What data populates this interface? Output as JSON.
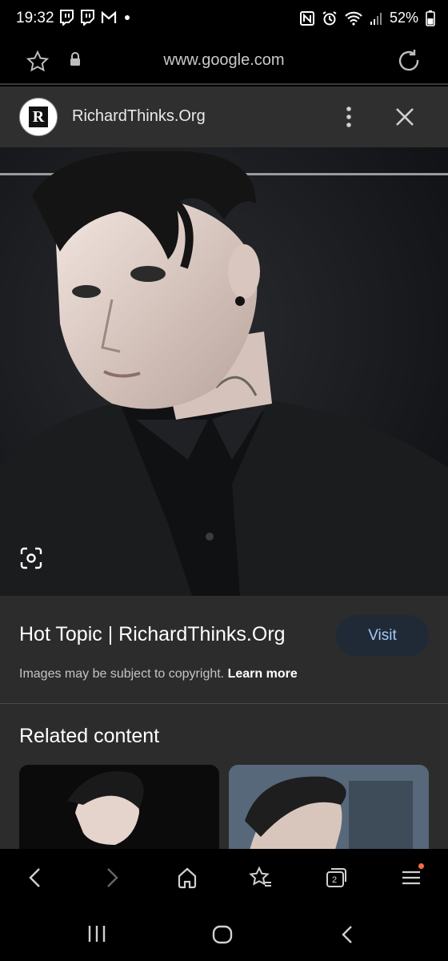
{
  "status_bar": {
    "time": "19:32",
    "battery_pct": "52%",
    "notification_icons": [
      "twitch-icon",
      "twitch-icon",
      "gmail-icon",
      "dot-icon"
    ],
    "system_icons": [
      "nfc-icon",
      "alarm-icon",
      "wifi-icon",
      "signal-icon",
      "battery-icon"
    ]
  },
  "url_bar": {
    "url": "www.google.com"
  },
  "panel": {
    "site_name": "RichardThinks.Org",
    "favicon_letter": "R"
  },
  "result": {
    "title": "Hot Topic | RichardThinks.Org",
    "visit_label": "Visit",
    "copyright_text": "Images may be subject to copyright.",
    "learn_more": "Learn more"
  },
  "related": {
    "heading": "Related content"
  },
  "toolbar": {
    "tab_count": "2"
  },
  "colors": {
    "panel_bg": "#2c2c2c",
    "visit_bg": "#1f2a36",
    "visit_text": "#a8c7fa",
    "menu_badge": "#ff6a3d"
  }
}
